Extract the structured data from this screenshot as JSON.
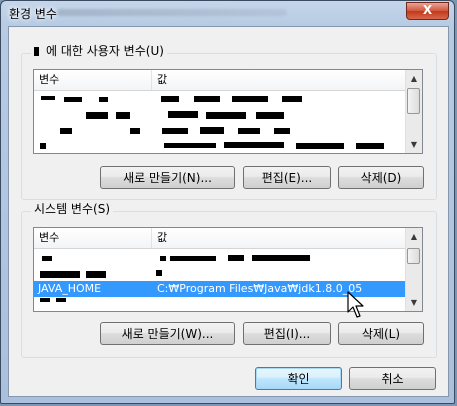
{
  "window": {
    "title": "환경 변수",
    "close_glyph": "X"
  },
  "user_vars": {
    "group_label": "에 대한 사용자 변수(U)",
    "columns": {
      "name": "변수",
      "value": "값"
    },
    "new_button": "새로 만들기(N)...",
    "edit_button": "편집(E)...",
    "delete_button": "삭제(D)"
  },
  "system_vars": {
    "group_label": "시스템 변수(S)",
    "columns": {
      "name": "변수",
      "value": "값"
    },
    "selected_row": {
      "name": "JAVA_HOME",
      "value": "C:₩Program Files₩Java₩jdk1.8.0_05"
    },
    "new_button": "새로 만들기(W)...",
    "edit_button": "편집(I)...",
    "delete_button": "삭제(L)"
  },
  "footer": {
    "ok_button": "확인",
    "cancel_button": "취소"
  },
  "colors": {
    "selection": "#3399ff",
    "close_button": "#c2391c",
    "window_frame": "#aac0dc"
  },
  "icons": {
    "close": "close-icon",
    "scroll_up": "scroll-up-arrow-icon",
    "scroll_down": "scroll-down-arrow-icon",
    "cursor": "mouse-pointer-icon"
  }
}
